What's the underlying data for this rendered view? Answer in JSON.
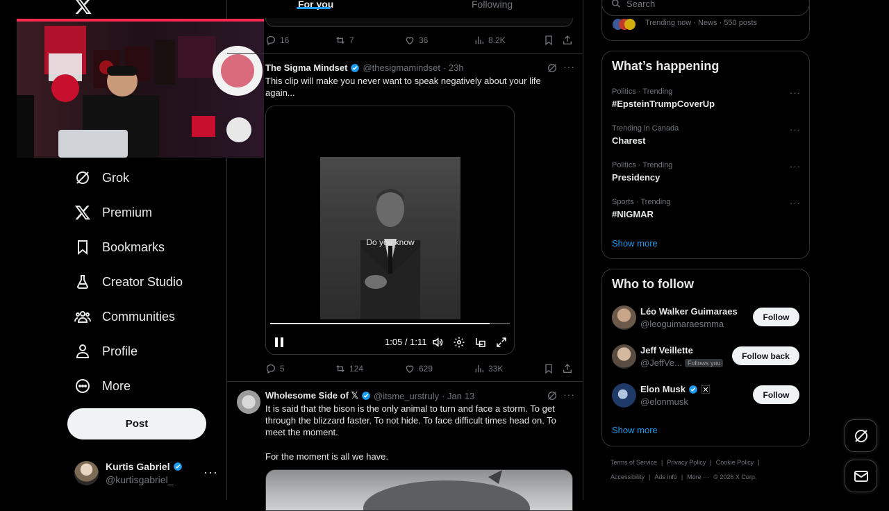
{
  "colors": {
    "accent": "#1d9bf0",
    "background": "#000000",
    "text": "#e7e9ea",
    "muted": "#71767b",
    "border": "#2f3336"
  },
  "nav": {
    "items": [
      {
        "label": "Grok",
        "icon": "grok-icon"
      },
      {
        "label": "Premium",
        "icon": "x-logo-icon"
      },
      {
        "label": "Bookmarks",
        "icon": "bookmark-icon"
      },
      {
        "label": "Creator Studio",
        "icon": "flask-icon"
      },
      {
        "label": "Communities",
        "icon": "people-icon"
      },
      {
        "label": "Profile",
        "icon": "person-icon"
      },
      {
        "label": "More",
        "icon": "more-circle-icon"
      }
    ],
    "post_label": "Post",
    "profile": {
      "name": "Kurtis Gabriel",
      "handle": "@kurtisgabriel_"
    }
  },
  "feed": {
    "tabs": [
      "For you",
      "Following"
    ],
    "prev_actions": {
      "replies": "16",
      "reposts": "7",
      "likes": "36",
      "views": "8.2K"
    },
    "tweet1": {
      "name": "The Sigma Mindset",
      "handle": "@thesigmamindset",
      "time": "· 23h",
      "text": "This clip will make you never want to speak negatively about your life again...",
      "video": {
        "caption": "Do you know",
        "time": "1:05 / 1:11",
        "progress": 0.915
      },
      "actions": {
        "replies": "5",
        "reposts": "124",
        "likes": "629",
        "views": "33K"
      }
    },
    "tweet2": {
      "name": "Wholesome Side of 𝕏",
      "handle": "@itsme_urstruly",
      "time": "· Jan 13",
      "text1": "It is said that the bison is the only animal to turn and face a storm. To get through the blizzard faster. To not hide. To face difficult times head on. To meet the moment.",
      "text2": "For the moment is all we have."
    }
  },
  "right": {
    "search_placeholder": "Search",
    "trending_now": "Trending now · News · 550 posts",
    "happening_title": "What’s happening",
    "trends": [
      {
        "meta": "Politics · Trending",
        "name": "#EpsteinTrumpCoverUp"
      },
      {
        "meta": "Trending in Canada",
        "name": "Charest"
      },
      {
        "meta": "Politics · Trending",
        "name": "Presidency"
      },
      {
        "meta": "Sports · Trending",
        "name": "#NIGMAR"
      }
    ],
    "show_more": "Show more",
    "follow_title": "Who to follow",
    "follow": [
      {
        "name": "Léo Walker Guimaraes",
        "handle": "@leoguimaraesmma",
        "button": "Follow"
      },
      {
        "name": "Jeff Veillette",
        "handle": "@JeffVe...",
        "badge": "Follows you",
        "button": "Follow back"
      },
      {
        "name": "Elon Musk",
        "handle": "@elonmusk",
        "button": "Follow"
      }
    ],
    "footer_row1": [
      "Terms of Service",
      "|",
      "Privacy Policy",
      "|",
      "Cookie Policy",
      "|"
    ],
    "footer_row2": [
      "Accessibility",
      "|",
      "Ads info",
      "|",
      "More ···",
      "© 2026 X Corp."
    ]
  }
}
